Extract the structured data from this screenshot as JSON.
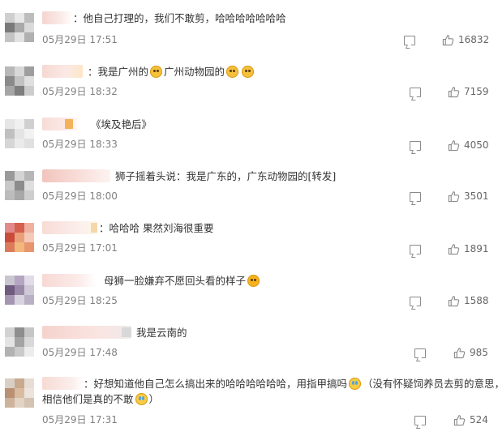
{
  "comments": [
    {
      "text": "：他自己打理的，我们不敢剪，哈哈哈哈哈哈哈",
      "time": "05月29日 17:51",
      "likes": "16832"
    },
    {
      "text_a": "：我是广州的",
      "text_b": "广州动物园的",
      "time": "05月29日 18:32",
      "likes": "7159"
    },
    {
      "text": "《埃及艳后》",
      "time": "05月29日 18:33",
      "likes": "4050"
    },
    {
      "text": "狮子摇着头说：我是广东的，广东动物园的[转发]",
      "time": "05月29日 18:00",
      "likes": "3501"
    },
    {
      "text": "：哈哈哈 果然刘海很重要",
      "time": "05月29日 17:01",
      "likes": "1891"
    },
    {
      "text": "母狮一脸嫌弃不愿回头看的样子",
      "time": "05月29日 18:25",
      "likes": "1588"
    },
    {
      "text": "我是云南的",
      "time": "05月29日 17:48",
      "likes": "985"
    },
    {
      "text_a": "：好想知道他自己怎么搞出来的哈哈哈哈哈哈，用指甲搞吗",
      "text_b": "（没有怀疑饲养员去剪的意思，",
      "text_c": "相信他们是真的不敢",
      "text_d": "）",
      "time": "05月29日 17:31",
      "likes": "524"
    }
  ],
  "icons": {
    "reply": "comment-icon",
    "like": "thumbs-up-icon",
    "emoji_dog": "dog-face-emoji",
    "emoji_laugh": "laughing-emoji",
    "emoji_cry_laugh": "tears-of-joy-emoji"
  }
}
